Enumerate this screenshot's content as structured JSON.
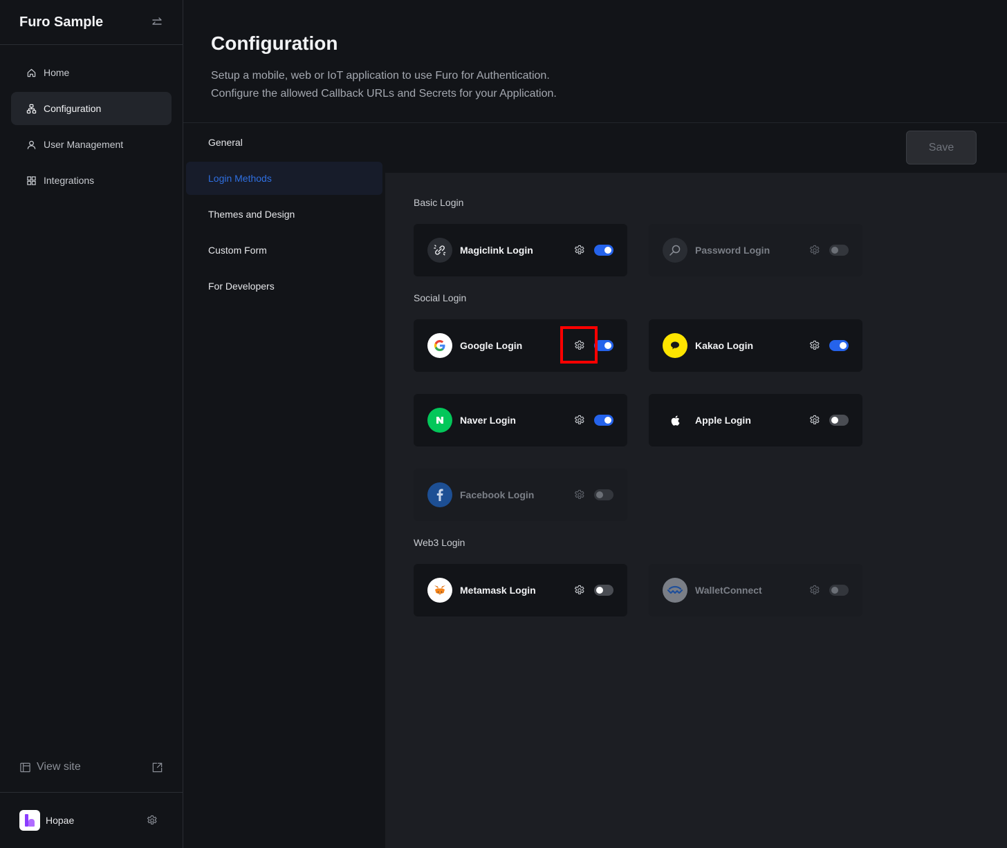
{
  "sidebar": {
    "app_title": "Furo Sample",
    "nav": [
      {
        "label": "Home",
        "icon": "home-icon",
        "active": false
      },
      {
        "label": "Configuration",
        "icon": "sitemap-icon",
        "active": true
      },
      {
        "label": "User Management",
        "icon": "user-icon",
        "active": false
      },
      {
        "label": "Integrations",
        "icon": "grid-icon",
        "active": false
      }
    ],
    "view_site_label": "View site",
    "workspace_name": "Hopae"
  },
  "header": {
    "title": "Configuration",
    "description_line1": "Setup a mobile, web or IoT application to use Furo for Authentication.",
    "description_line2": "Configure the allowed Callback URLs and Secrets for your Application."
  },
  "subnav": [
    {
      "label": "General",
      "active": false
    },
    {
      "label": "Login Methods",
      "active": true
    },
    {
      "label": "Themes and Design",
      "active": false
    },
    {
      "label": "Custom Form",
      "active": false
    },
    {
      "label": "For Developers",
      "active": false
    }
  ],
  "toolbar": {
    "save_label": "Save"
  },
  "sections": {
    "basic": "Basic Login",
    "social": "Social Login",
    "web3": "Web3 Login"
  },
  "methods": {
    "magiclink": {
      "label": "Magiclink Login",
      "enabled": true
    },
    "password": {
      "label": "Password Login",
      "enabled": false
    },
    "google": {
      "label": "Google Login",
      "enabled": true
    },
    "kakao": {
      "label": "Kakao Login",
      "enabled": true
    },
    "naver": {
      "label": "Naver Login",
      "enabled": true
    },
    "apple": {
      "label": "Apple Login",
      "enabled": false
    },
    "facebook": {
      "label": "Facebook Login",
      "enabled": false
    },
    "metamask": {
      "label": "Metamask Login",
      "enabled": false
    },
    "walletconnect": {
      "label": "WalletConnect",
      "enabled": false
    }
  },
  "colors": {
    "accent": "#2563eb",
    "highlight": "#ff0000",
    "kakao": "#fee500",
    "naver": "#03c75a",
    "facebook": "#1877f2"
  }
}
